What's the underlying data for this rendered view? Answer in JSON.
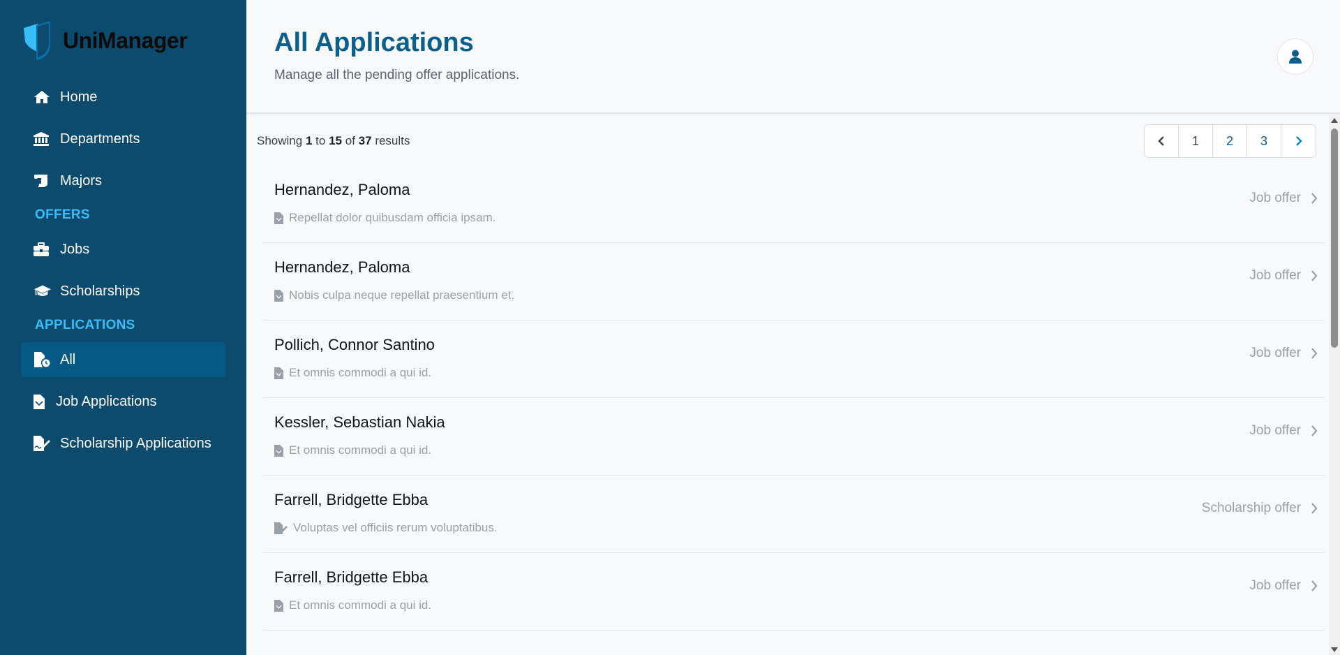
{
  "app": {
    "name": "UniManager"
  },
  "sidebar": {
    "items": [
      {
        "label": "Home",
        "icon": "home-icon"
      },
      {
        "label": "Departments",
        "icon": "building-columns-icon"
      },
      {
        "label": "Majors",
        "icon": "scroll-icon"
      }
    ],
    "offers_title": "OFFERS",
    "offers": [
      {
        "label": "Jobs",
        "icon": "briefcase-icon"
      },
      {
        "label": "Scholarships",
        "icon": "graduation-cap-icon"
      }
    ],
    "applications_title": "APPLICATIONS",
    "applications": [
      {
        "label": "All",
        "icon": "file-clock-icon",
        "active": true
      },
      {
        "label": "Job Applications",
        "icon": "file-icon"
      },
      {
        "label": "Scholarship Applications",
        "icon": "file-signature-icon"
      }
    ]
  },
  "header": {
    "title": "All Applications",
    "subtitle": "Manage all the pending offer applications."
  },
  "results": {
    "prefix": "Showing",
    "from": "1",
    "to_word": "to",
    "to": "15",
    "of_word": "of",
    "total": "37",
    "suffix": "results"
  },
  "pagination": {
    "pages": [
      "1",
      "2",
      "3"
    ]
  },
  "applications": [
    {
      "name": "Hernandez, Paloma",
      "description": "Repellat dolor quibusdam officia ipsam.",
      "type": "Job offer"
    },
    {
      "name": "Hernandez, Paloma",
      "description": "Nobis culpa neque repellat praesentium et.",
      "type": "Job offer"
    },
    {
      "name": "Pollich, Connor Santino",
      "description": "Et omnis commodi a qui id.",
      "type": "Job offer"
    },
    {
      "name": "Kessler, Sebastian Nakia",
      "description": "Et omnis commodi a qui id.",
      "type": "Job offer"
    },
    {
      "name": "Farrell, Bridgette Ebba",
      "description": "Voluptas vel officiis rerum voluptatibus.",
      "type": "Scholarship offer"
    },
    {
      "name": "Farrell, Bridgette Ebba",
      "description": "Et omnis commodi a qui id.",
      "type": "Job offer"
    }
  ],
  "colors": {
    "sidebar_bg": "#0c4a6e",
    "active_bg": "#075985",
    "accent": "#38bdf8",
    "title": "#0b5f8c"
  }
}
